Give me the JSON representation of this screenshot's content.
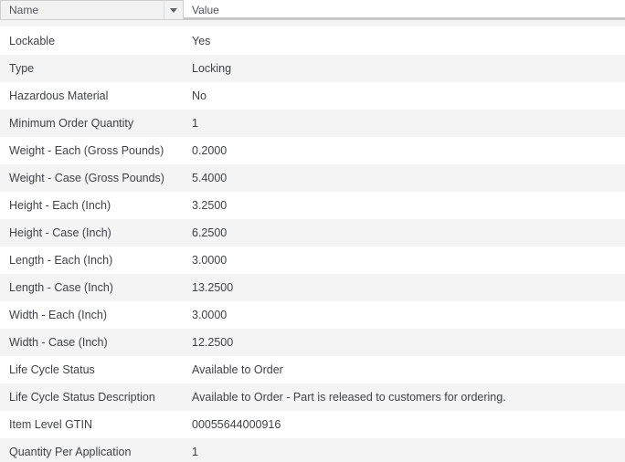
{
  "header": {
    "name_label": "Name",
    "value_label": "Value"
  },
  "icons": {
    "name_header_dropdown": "chevron-down-icon"
  },
  "colors": {
    "header_cell_bg": "#f2f2f2",
    "header_cell_border": "#cfcfcf",
    "header_divider": "#c9c9c9",
    "row_alt_bg": "#f4f4f4",
    "row_bg": "#ffffff",
    "text": "#3f4246",
    "header_text": "#4f5358"
  },
  "table": {
    "columns": [
      "Name",
      "Value"
    ],
    "rows": [
      {
        "name": "Lockable",
        "value": "Yes"
      },
      {
        "name": "Type",
        "value": "Locking"
      },
      {
        "name": "Hazardous Material",
        "value": "No"
      },
      {
        "name": "Minimum Order Quantity",
        "value": "1"
      },
      {
        "name": "Weight - Each (Gross Pounds)",
        "value": "0.2000"
      },
      {
        "name": "Weight - Case (Gross Pounds)",
        "value": "5.4000"
      },
      {
        "name": "Height - Each (Inch)",
        "value": "3.2500"
      },
      {
        "name": "Height - Case (Inch)",
        "value": "6.2500"
      },
      {
        "name": "Length - Each (Inch)",
        "value": "3.0000"
      },
      {
        "name": "Length - Case (Inch)",
        "value": "13.2500"
      },
      {
        "name": "Width - Each (Inch)",
        "value": "3.0000"
      },
      {
        "name": "Width - Case (Inch)",
        "value": "12.2500"
      },
      {
        "name": "Life Cycle Status",
        "value": "Available to Order"
      },
      {
        "name": "Life Cycle Status Description",
        "value": "Available to Order - Part is released to customers for ordering."
      },
      {
        "name": "Item Level GTIN",
        "value": "00055644000916"
      },
      {
        "name": "Quantity Per Application",
        "value": "1"
      }
    ]
  }
}
